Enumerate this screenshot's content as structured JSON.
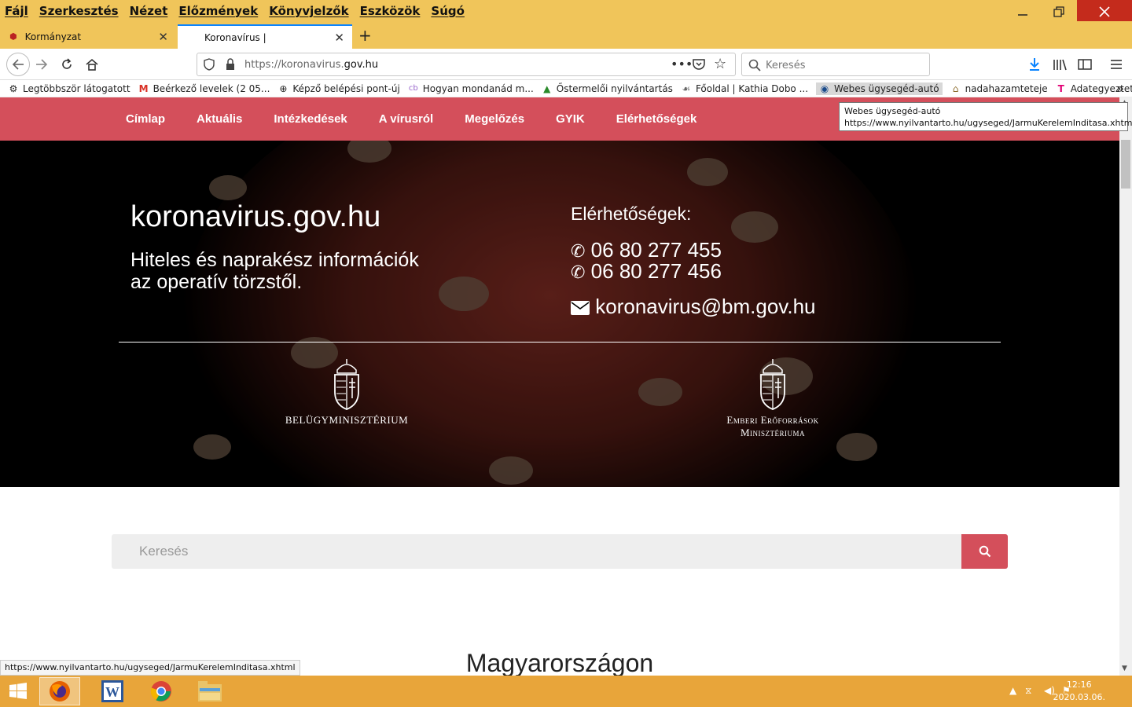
{
  "menu": [
    "Fájl",
    "Szerkesztés",
    "Nézet",
    "Előzmények",
    "Könyvjelzők",
    "Eszközök",
    "Súgó"
  ],
  "tabs": [
    {
      "label": "Kormányzat"
    },
    {
      "label": "Koronavírus |"
    }
  ],
  "url": {
    "prefix": "https://koronavirus.",
    "domain": "gov.hu"
  },
  "browser_search_placeholder": "Keresés",
  "bookmarks": [
    {
      "label": "Legtöbbször látogatott",
      "icon": "gear-icon"
    },
    {
      "label": "Beérkező levelek (2 05...",
      "icon": "gmail-icon"
    },
    {
      "label": "Képző belépési pont-új",
      "icon": "globe-icon"
    },
    {
      "label": "Hogyan mondanád m...",
      "icon": "cb-icon"
    },
    {
      "label": "Őstermelői nyilvántartás",
      "icon": "chart-icon"
    },
    {
      "label": "Főoldal | Kathia Dobo ...",
      "icon": "leaf-icon"
    },
    {
      "label": "Webes ügysegéd-autó",
      "icon": "car-icon"
    },
    {
      "label": "nadahazamteteje",
      "icon": "house-icon"
    },
    {
      "label": "Adategyeztetés feltölt...",
      "icon": "telekom-icon"
    }
  ],
  "tooltip": {
    "title": "Webes ügysegéd-autó",
    "url": "https://www.nyilvantarto.hu/ugyseged/JarmuKerelemInditasa.xhtml"
  },
  "site_nav": [
    "Címlap",
    "Aktuális",
    "Intézkedések",
    "A vírusról",
    "Megelőzés",
    "GYIK",
    "Elérhetőségek"
  ],
  "hero": {
    "title": "koronavirus.gov.hu",
    "subtitle_line1": "Hiteles és naprakész információk",
    "subtitle_line2": "az operatív törzstől.",
    "contacts_heading": "Elérhetőségek:",
    "phone1": "06 80 277 455",
    "phone2": "06 80 277 456",
    "email": "koronavirus@bm.gov.hu",
    "ministry1": "Belügyminisztérium",
    "ministry2_line1": "Emberi Erőforrások",
    "ministry2_line2": "Minisztériuma"
  },
  "page_search_placeholder": "Keresés",
  "section_heading": "Magyarországon",
  "status_url": "https://www.nyilvantarto.hu/ugyseged/JarmuKerelemInditasa.xhtml",
  "clock": {
    "time": "12:16",
    "date": "2020.03.06."
  },
  "colors": {
    "chrome": "#f0c55a",
    "accent": "#d44f5b",
    "taskbar": "#e8a53a"
  }
}
